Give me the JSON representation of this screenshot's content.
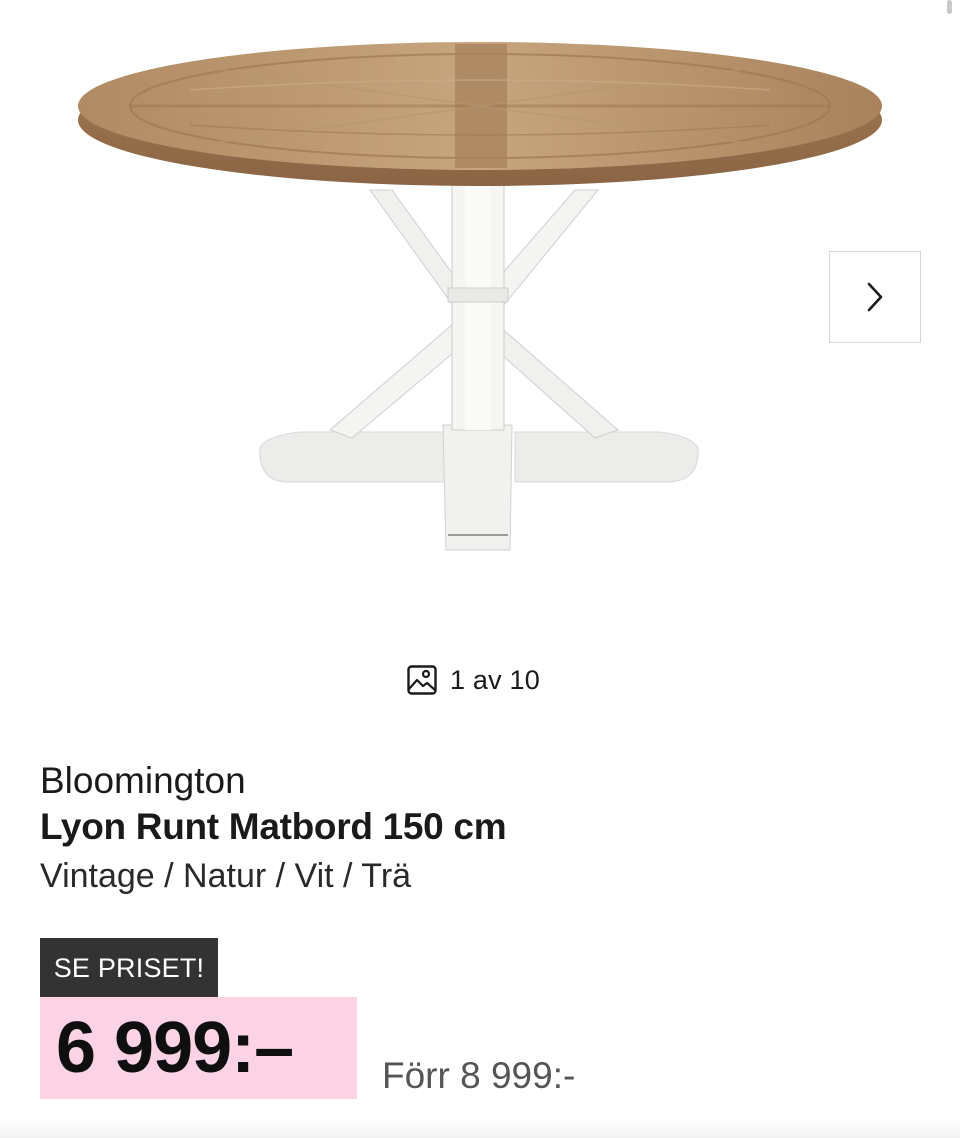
{
  "gallery": {
    "image_alt": "Lyon Runt Matbord 150 cm",
    "counter_text": "1 av 10",
    "next_icon": "chevron-right-icon",
    "counter_icon": "image-icon"
  },
  "product": {
    "brand": "Bloomington",
    "title": "Lyon Runt Matbord 150 cm",
    "variant": "Vintage / Natur / Vit / Trä"
  },
  "pricing": {
    "badge": "SE PRISET!",
    "price": "6 999:–",
    "old_price": "Förr 8 999:-",
    "price_bg_color": "#fbd3e5",
    "badge_bg_color": "#333333"
  }
}
